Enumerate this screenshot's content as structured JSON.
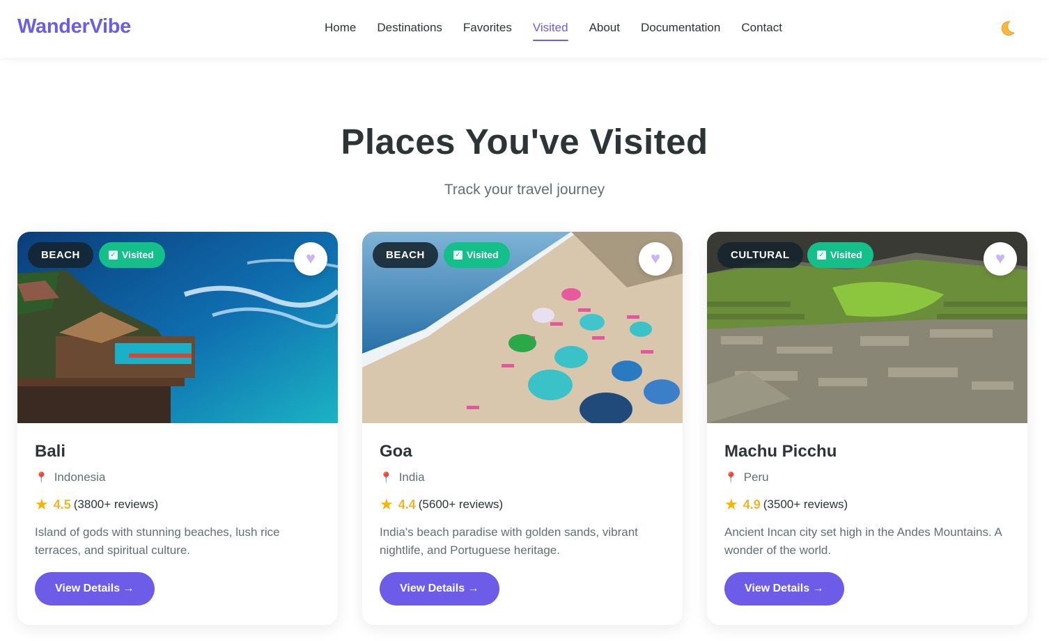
{
  "brand": {
    "name": "WanderVibe",
    "accent": "#6c5ce7"
  },
  "nav": {
    "items": [
      {
        "label": "Home"
      },
      {
        "label": "Destinations"
      },
      {
        "label": "Favorites"
      },
      {
        "label": "Visited",
        "active": true
      },
      {
        "label": "About"
      },
      {
        "label": "Documentation"
      },
      {
        "label": "Contact"
      }
    ],
    "theme_icon": "moon-icon"
  },
  "page": {
    "title": "Places You've Visited",
    "subtitle": "Track your travel journey"
  },
  "cards": [
    {
      "category": "BEACH",
      "visited_label": "Visited",
      "name": "Bali",
      "location": "Indonesia",
      "rating": "4.5",
      "reviews": "(3800+ reviews)",
      "description": "Island of gods with stunning beaches, lush rice terraces, and spiritual culture.",
      "button": "View Details →"
    },
    {
      "category": "BEACH",
      "visited_label": "Visited",
      "name": "Goa",
      "location": "India",
      "rating": "4.4",
      "reviews": "(5600+ reviews)",
      "description": "India's beach paradise with golden sands, vibrant nightlife, and Portuguese heritage.",
      "button": "View Details →"
    },
    {
      "category": "CULTURAL",
      "visited_label": "Visited",
      "name": "Machu Picchu",
      "location": "Peru",
      "rating": "4.9",
      "reviews": "(3500+ reviews)",
      "description": "Ancient Incan city set high in the Andes Mountains. A wonder of the world.",
      "button": "View Details →"
    }
  ],
  "colors": {
    "visited_badge": "#14bf8a",
    "rating": "#f0b429",
    "pin": "#e84393"
  }
}
